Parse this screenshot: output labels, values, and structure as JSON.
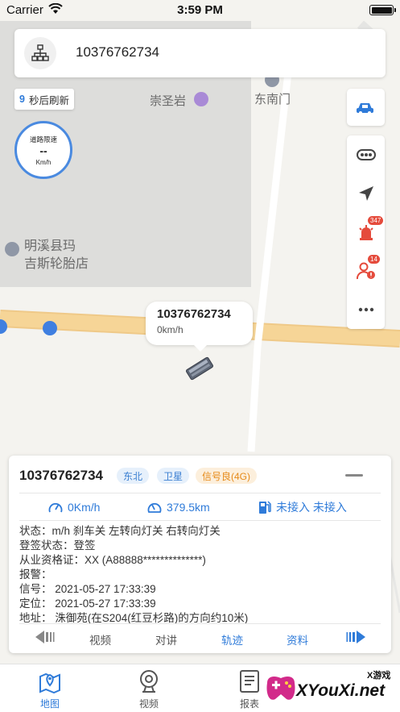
{
  "status_bar": {
    "carrier": "Carrier",
    "time": "3:59 PM"
  },
  "search": {
    "value": "10376762734"
  },
  "refresh": {
    "count": "9",
    "label": "秒后刷新"
  },
  "speed_limit": {
    "title": "道路限速",
    "value": "--",
    "unit": "Km/h"
  },
  "map": {
    "pois": [
      "崇圣岩",
      "东南门",
      "明溪县玛",
      "吉斯轮胎店"
    ]
  },
  "toolbar": {
    "alarm_badge": "347",
    "driver_badge": "14"
  },
  "popup": {
    "plate": "10376762734",
    "speed": "0km/h"
  },
  "vehicle": {
    "plate": "10376762734",
    "tags": [
      "东北",
      "卫星",
      "信号良(4G)"
    ],
    "speed": "0Km/h",
    "mileage": "379.5km",
    "fuel": "未接入 未接入",
    "lines": [
      "状态：m/h 刹车关 左转向灯关 右转向灯关",
      "登签状态：登签",
      "从业资格证：XX (A88888**************)",
      "报警：",
      "信号：  2021-05-27 17:33:39",
      "定位：  2021-05-27 17:33:39",
      "地址：  洙御苑(在S204(红豆杉路)的方向约10米)"
    ],
    "actions": [
      "视频",
      "对讲",
      "轨迹",
      "资料"
    ]
  },
  "tabs": [
    {
      "label": "地图",
      "icon": "map-pin-icon",
      "active": true
    },
    {
      "label": "视频",
      "icon": "camera-icon",
      "active": false
    },
    {
      "label": "报表",
      "icon": "report-icon",
      "active": false
    }
  ],
  "watermark": {
    "small": "X游戏",
    "big": "XYouXi.net"
  },
  "colors": {
    "accent": "#2f7bd9",
    "alarm": "#e54b3c",
    "road": "#f5c97a"
  }
}
